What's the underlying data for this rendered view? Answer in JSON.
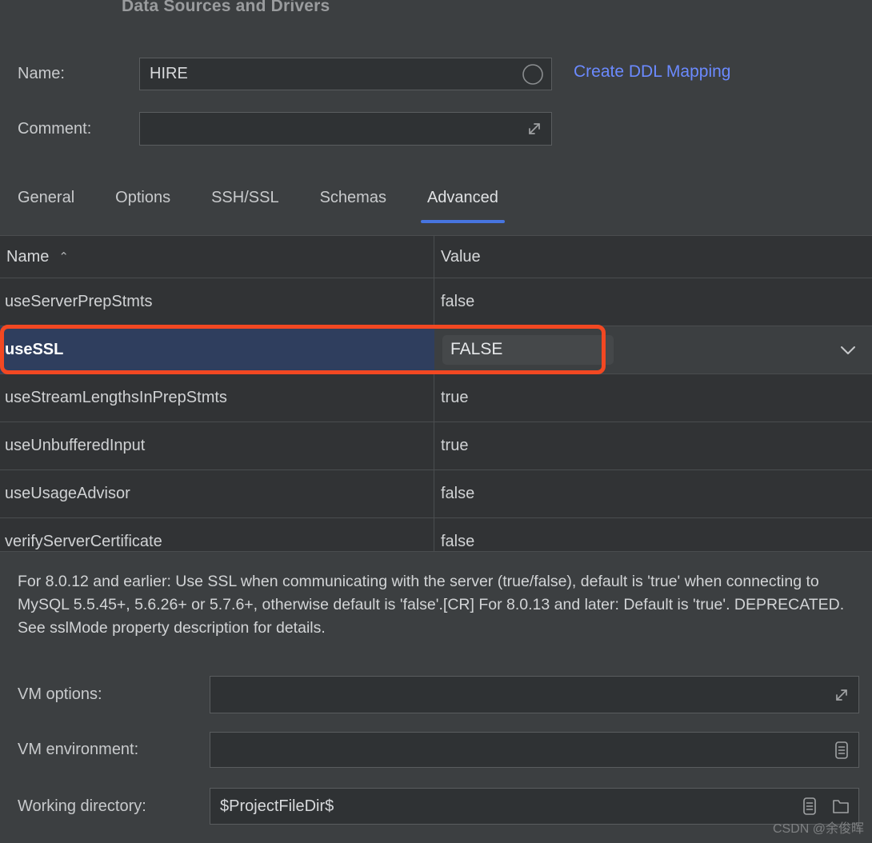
{
  "window": {
    "title": "Data Sources and Drivers"
  },
  "form": {
    "name_label": "Name:",
    "name_value": "HIRE",
    "comment_label": "Comment:",
    "comment_value": "",
    "create_ddl_link": "Create DDL Mapping"
  },
  "tabs": [
    {
      "label": "General",
      "selected": false
    },
    {
      "label": "Options",
      "selected": false
    },
    {
      "label": "SSH/SSL",
      "selected": false
    },
    {
      "label": "Schemas",
      "selected": false
    },
    {
      "label": "Advanced",
      "selected": true
    }
  ],
  "table": {
    "columns": [
      "Name",
      "Value"
    ],
    "sort_indicator": "⌃",
    "rows": [
      {
        "name": "useServerPrepStmts",
        "value": "false",
        "selected": false
      },
      {
        "name": "useSSL",
        "value": "FALSE",
        "selected": true
      },
      {
        "name": "useStreamLengthsInPrepStmts",
        "value": "true",
        "selected": false
      },
      {
        "name": "useUnbufferedInput",
        "value": "true",
        "selected": false
      },
      {
        "name": "useUsageAdvisor",
        "value": "false",
        "selected": false
      },
      {
        "name": "verifyServerCertificate",
        "value": "false",
        "selected": false
      }
    ]
  },
  "description": "For 8.0.12 and earlier: Use SSL when communicating with the server (true/false), default is 'true' when connecting to MySQL 5.5.45+, 5.6.26+ or 5.7.6+, otherwise default is 'false'.[CR] For 8.0.13 and later: Default is 'true'. DEPRECATED. See sslMode property description for details.",
  "bottom": {
    "vm_options_label": "VM options:",
    "vm_options_value": "",
    "vm_environment_label": "VM environment:",
    "vm_environment_value": "",
    "working_directory_label": "Working directory:",
    "working_directory_value": "$ProjectFileDir$"
  },
  "watermark": "CSDN @余俊晖",
  "colors": {
    "background": "#3C3F41",
    "accent": "#4775E0",
    "link": "#6B8AFF",
    "selection": "#2F3E5E",
    "annotation": "#F24822"
  }
}
